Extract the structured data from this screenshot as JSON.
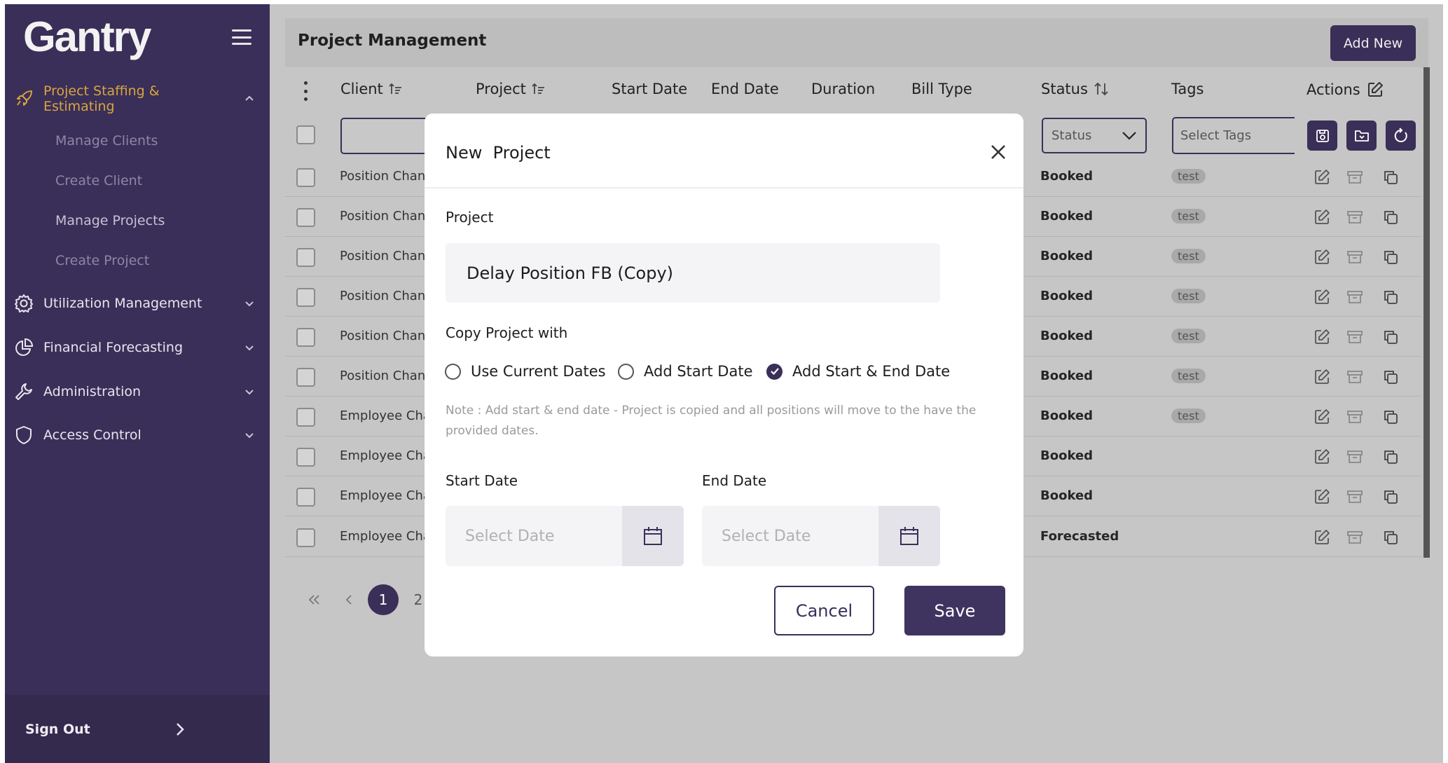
{
  "brand": {
    "logo_text": "Gantry"
  },
  "sidebar": {
    "sections": [
      {
        "label": "Project Staffing & Estimating",
        "icon": "rocket-icon",
        "expanded": true
      },
      {
        "label": "Utilization Management",
        "icon": "gear-icon",
        "expanded": false
      },
      {
        "label": "Financial Forecasting",
        "icon": "pie-chart-icon",
        "expanded": false
      },
      {
        "label": "Administration",
        "icon": "wrench-icon",
        "expanded": false
      },
      {
        "label": "Access Control",
        "icon": "shield-icon",
        "expanded": false
      }
    ],
    "sub_items": [
      "Manage Clients",
      "Create Client",
      "Manage Projects",
      "Create Project"
    ],
    "sign_out": "Sign Out"
  },
  "page": {
    "title": "Project Management",
    "add_new": "Add New"
  },
  "table": {
    "columns": [
      "Client",
      "Project",
      "Start Date",
      "End Date",
      "Duration",
      "Bill Type",
      "Status",
      "Tags",
      "Actions"
    ],
    "filters": {
      "status_placeholder": "Status",
      "tags_placeholder": "Select Tags"
    },
    "rows": [
      {
        "client": "Position Chan",
        "status": "Booked",
        "tag": "test"
      },
      {
        "client": "Position Chan",
        "status": "Booked",
        "tag": "test"
      },
      {
        "client": "Position Chan",
        "status": "Booked",
        "tag": "test"
      },
      {
        "client": "Position Chan",
        "status": "Booked",
        "tag": "test"
      },
      {
        "client": "Position Chan",
        "status": "Booked",
        "tag": "test"
      },
      {
        "client": "Position Chan",
        "status": "Booked",
        "tag": "test"
      },
      {
        "client": "Employee Cha",
        "status": "Booked",
        "tag": "test"
      },
      {
        "client": "Employee Cha",
        "status": "Booked",
        "tag": ""
      },
      {
        "client": "Employee Cha",
        "status": "Booked",
        "tag": ""
      },
      {
        "client": "Employee Cha",
        "status": "Forecasted",
        "tag": ""
      }
    ],
    "pagination": {
      "pages": [
        "1",
        "2"
      ],
      "current": "1"
    }
  },
  "modal": {
    "title": "New  Project",
    "project_label": "Project",
    "project_value": "Delay Position FB (Copy)",
    "copy_with_label": "Copy Project with",
    "options": [
      {
        "label": "Use Current Dates",
        "checked": false
      },
      {
        "label": "Add Start Date",
        "checked": false
      },
      {
        "label": "Add Start & End Date",
        "checked": true
      }
    ],
    "note": "Note : Add start & end date - Project is copied and all positions will move to the have the provided dates.",
    "start_date_label": "Start Date",
    "end_date_label": "End Date",
    "date_placeholder": "Select Date",
    "cancel": "Cancel",
    "save": "Save"
  },
  "colors": {
    "primary": "#3a2f58",
    "accent": "#d9a441",
    "overlay": "#c6c6c6",
    "surface": "#ffffff"
  }
}
